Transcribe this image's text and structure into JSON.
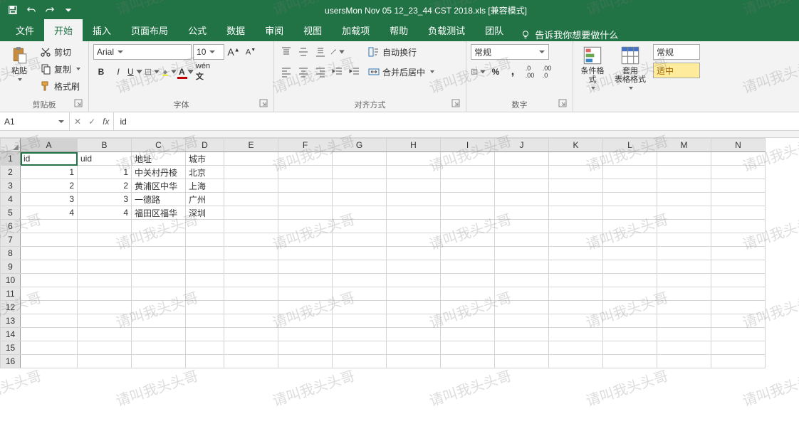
{
  "title": "usersMon Nov 05 12_23_44 CST 2018.xls  [兼容模式]",
  "tabs": {
    "file": "文件",
    "home": "开始",
    "insert": "插入",
    "layout": "页面布局",
    "formulas": "公式",
    "data": "数据",
    "review": "审阅",
    "view": "视图",
    "addins": "加载项",
    "help": "帮助",
    "loadtest": "负载测试",
    "team": "团队",
    "tellme": "告诉我你想要做什么"
  },
  "ribbon": {
    "clipboard": {
      "paste": "粘贴",
      "cut": "剪切",
      "copy": "复制",
      "format_painter": "格式刷",
      "label": "剪贴板"
    },
    "font": {
      "name": "Arial",
      "size": "10",
      "grow": "A",
      "shrink": "A",
      "label": "字体"
    },
    "align": {
      "wrap": "自动换行",
      "merge": "合并后居中",
      "label": "对齐方式"
    },
    "number": {
      "format": "常规",
      "label": "数字"
    },
    "styles": {
      "cond": "条件格式",
      "table": "套用\n表格格式",
      "normal": "常规",
      "neutral": "适中"
    }
  },
  "formula": {
    "name_box": "A1",
    "value": "id"
  },
  "columns": [
    "A",
    "B",
    "C",
    "D",
    "E",
    "F",
    "G",
    "H",
    "I",
    "J",
    "K",
    "L",
    "M",
    "N"
  ],
  "rows": [
    "1",
    "2",
    "3",
    "4",
    "5",
    "6",
    "7",
    "8",
    "9",
    "10",
    "11",
    "12",
    "13",
    "14",
    "15",
    "16"
  ],
  "data": {
    "r1": {
      "A": "id",
      "B": "uid",
      "C": "地址",
      "D": "城市"
    },
    "r2": {
      "A": "1",
      "B": "1",
      "C": "中关村丹棱",
      "D": "北京"
    },
    "r3": {
      "A": "2",
      "B": "2",
      "C": "黄浦区中华",
      "D": "上海"
    },
    "r4": {
      "A": "3",
      "B": "3",
      "C": "一德路",
      "D": "广州"
    },
    "r5": {
      "A": "4",
      "B": "4",
      "C": "福田区福华",
      "D": "深圳"
    }
  },
  "watermark": "请叫我头头哥"
}
